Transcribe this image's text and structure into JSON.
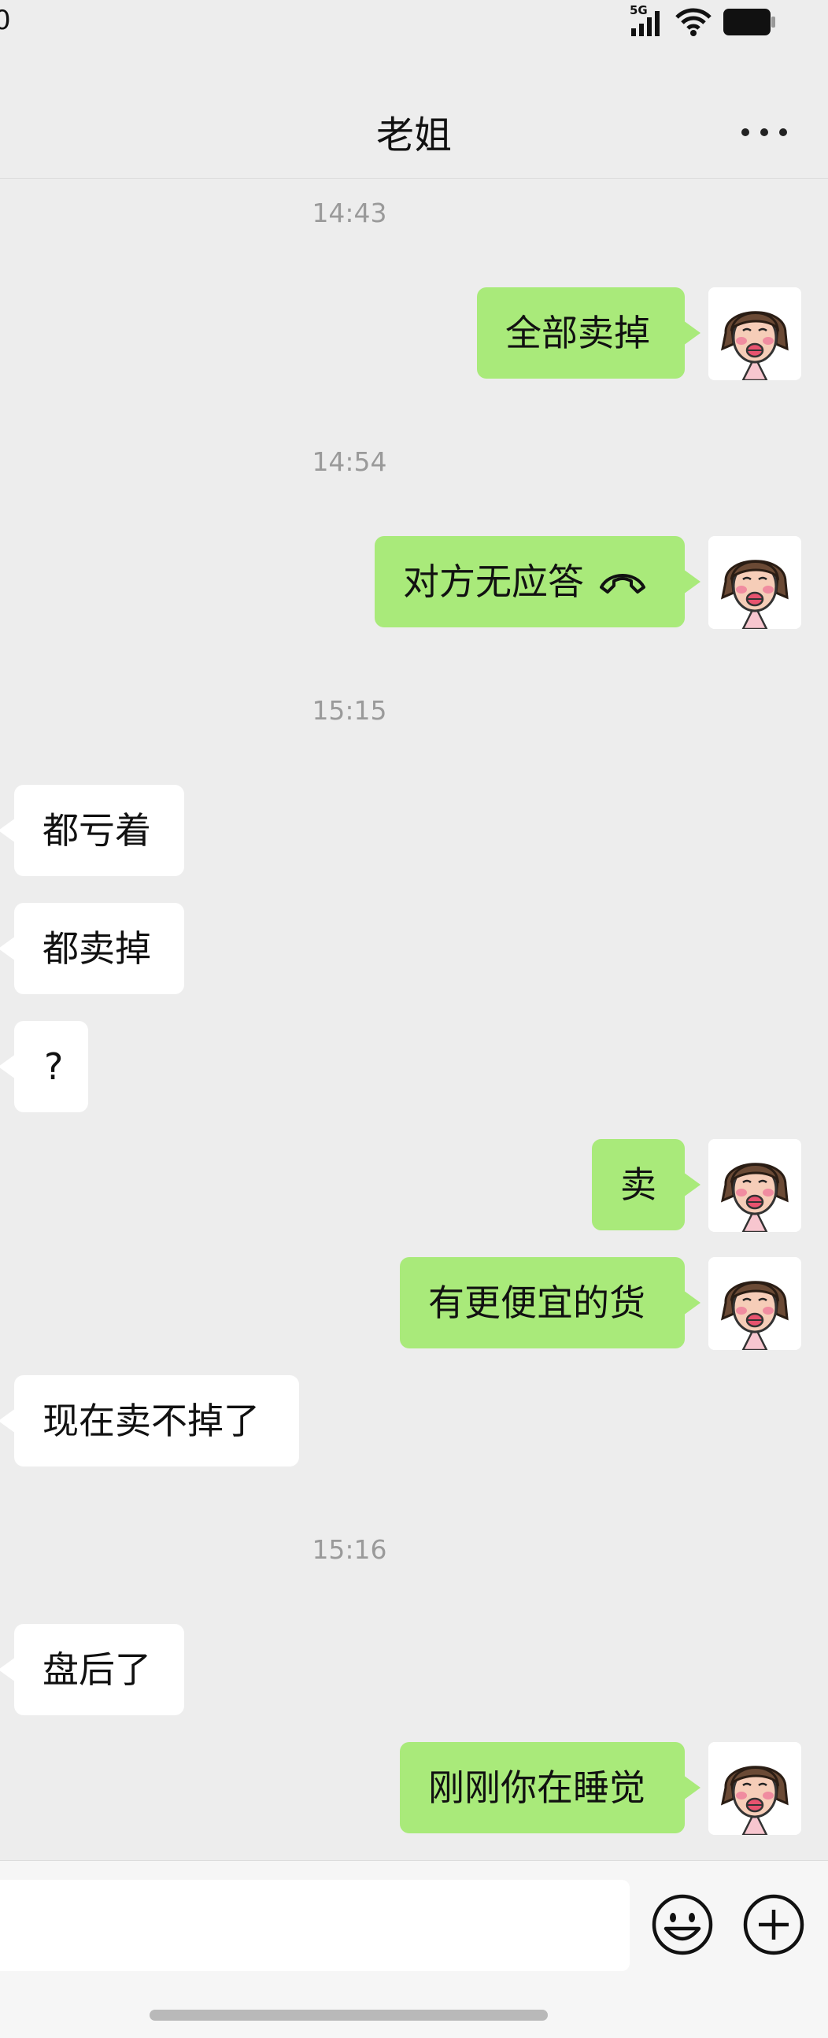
{
  "status_bar": {
    "time_partial": "0",
    "network": "5G"
  },
  "header": {
    "title": "老姐",
    "more_icon": "more-horizontal-icon"
  },
  "timestamps": [
    "14:43",
    "14:54",
    "15:15",
    "15:16"
  ],
  "messages": [
    {
      "side": "me",
      "text": "全部卖掉"
    },
    {
      "side": "me",
      "text": "对方无应答",
      "icon": "hang-up-icon"
    },
    {
      "side": "other",
      "text": "都亏着"
    },
    {
      "side": "other",
      "text": "都卖掉"
    },
    {
      "side": "other",
      "text": "?"
    },
    {
      "side": "me",
      "text": "卖"
    },
    {
      "side": "me",
      "text": "有更便宜的货"
    },
    {
      "side": "other",
      "text": "现在卖不掉了"
    },
    {
      "side": "other",
      "text": "盘后了"
    },
    {
      "side": "me",
      "text": "刚刚你在睡觉"
    }
  ],
  "input_bar": {
    "placeholder": "",
    "emoji_icon": "smiley-icon",
    "plus_icon": "plus-circle-icon"
  },
  "colors": {
    "my_bubble": "#a9ea7a",
    "other_bubble": "#ffffff",
    "background": "#ededed"
  }
}
